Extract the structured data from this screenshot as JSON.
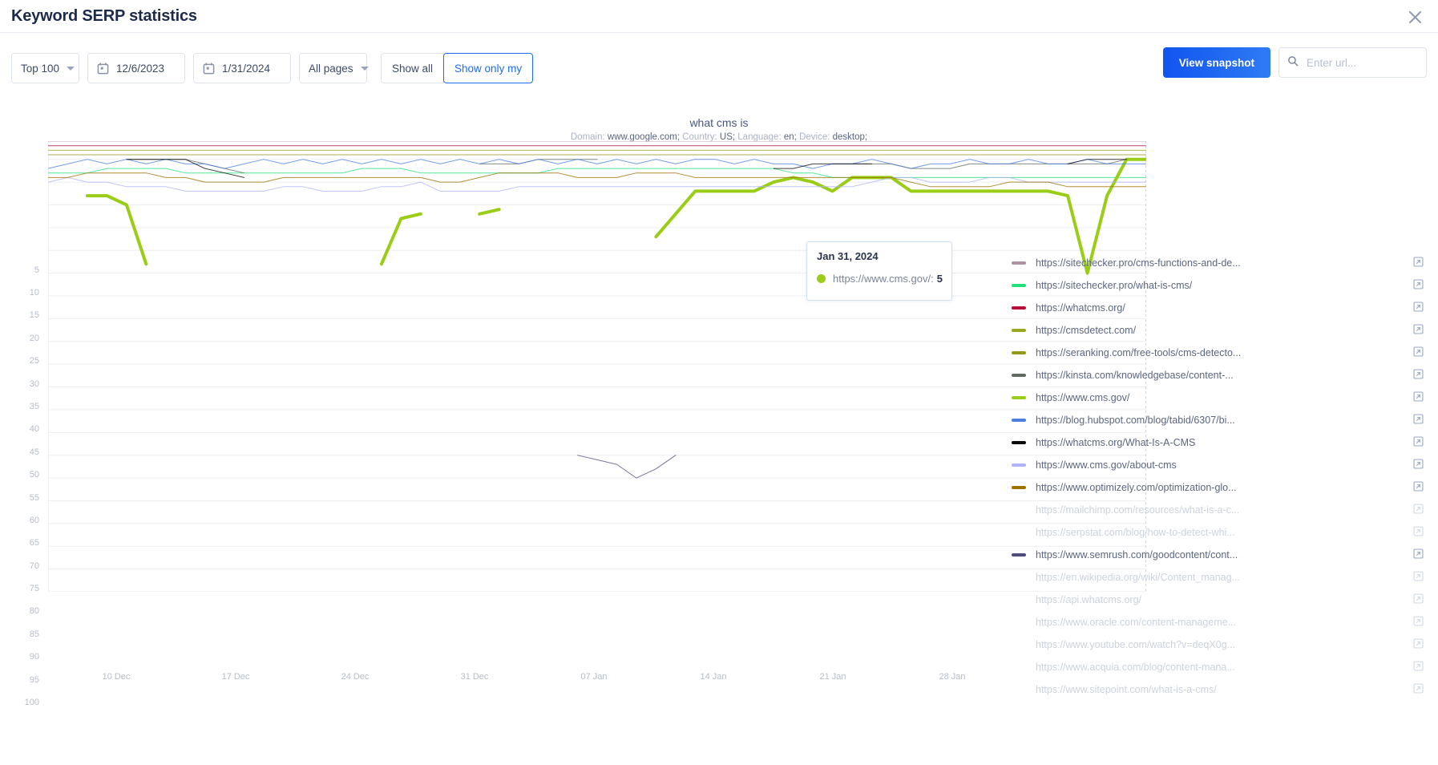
{
  "header": {
    "title": "Keyword SERP statistics",
    "close_icon": "close-icon"
  },
  "toolbar": {
    "top_select": "Top 100",
    "date_from": "12/6/2023",
    "date_to": "1/31/2024",
    "pages_select": "All pages",
    "show_all": "Show all",
    "show_only_my": "Show only my",
    "view_snapshot": "View snapshot",
    "url_placeholder": "Enter url...",
    "url_value": "",
    "accent": "#1c6ef2"
  },
  "tooltip": {
    "date": "Jan 31, 2024",
    "series_label": "https://www.cms.gov/:",
    "value": "5",
    "dot_color": "#9acd15"
  },
  "chart_data": {
    "type": "line",
    "title": "what cms is",
    "subtitle": "Domain: www.google.com; Country: US; Language: en; Device: desktop;",
    "subtitle_parts": [
      {
        "label": "Domain:",
        "value": "www.google.com;"
      },
      {
        "label": "Country:",
        "value": "US;"
      },
      {
        "label": "Language:",
        "value": "en;"
      },
      {
        "label": "Device:",
        "value": "desktop;"
      }
    ],
    "xlabel": "",
    "ylabel": "",
    "ylim": [
      1,
      100
    ],
    "y_inverted": true,
    "yticks": [
      5,
      10,
      15,
      20,
      25,
      30,
      35,
      40,
      45,
      50,
      55,
      60,
      65,
      70,
      75,
      80,
      85,
      90,
      95,
      100
    ],
    "xticks": [
      "10 Dec",
      "17 Dec",
      "24 Dec",
      "31 Dec",
      "07 Jan",
      "14 Jan",
      "21 Jan",
      "28 Jan"
    ],
    "x_start": "06 Dec 2023",
    "x_end": "31 Jan 2024",
    "grid": true,
    "legend_position": "right",
    "highlighted_series": "https://www.cms.gov/",
    "series": [
      {
        "name": "https://sitechecker.pro/cms-functions-and-de...",
        "color": "#ad92a0",
        "enabled": true,
        "values": [
          1,
          1,
          1,
          1,
          1,
          1,
          1,
          1,
          1,
          1,
          1,
          1,
          1,
          1,
          1,
          1,
          1,
          1,
          1,
          1,
          1,
          1,
          1,
          1,
          1,
          1,
          1,
          1,
          1,
          1,
          1,
          1,
          1,
          1,
          1,
          1,
          1,
          1,
          1,
          1,
          1,
          1,
          1,
          1,
          1,
          1,
          1,
          1,
          1,
          1,
          1,
          1,
          1,
          1,
          1,
          1,
          1
        ]
      },
      {
        "name": "https://sitechecker.pro/what-is-cms/",
        "color": "#1fe07a",
        "enabled": true,
        "values": [
          8,
          8,
          8,
          7,
          7,
          7,
          7,
          8,
          8,
          8,
          8,
          8,
          8,
          8,
          8,
          8,
          7,
          7,
          7,
          8,
          8,
          8,
          8,
          8,
          8,
          8,
          7,
          7,
          7,
          7,
          7,
          7,
          7,
          7,
          7,
          7,
          7,
          7,
          8,
          8,
          9,
          9,
          9,
          9,
          9,
          9,
          9,
          9,
          9,
          9,
          9,
          9,
          9,
          9,
          9,
          9,
          9
        ]
      },
      {
        "name": "https://whatcms.org/",
        "color": "#bb0c3c",
        "enabled": true,
        "values": [
          2,
          2,
          2,
          2,
          2,
          2,
          2,
          2,
          2,
          2,
          2,
          2,
          2,
          2,
          2,
          2,
          2,
          2,
          2,
          2,
          2,
          2,
          2,
          2,
          2,
          2,
          2,
          2,
          2,
          2,
          2,
          2,
          2,
          2,
          2,
          2,
          2,
          2,
          2,
          2,
          2,
          2,
          2,
          2,
          2,
          2,
          2,
          2,
          2,
          2,
          2,
          2,
          2,
          2,
          2,
          2,
          2
        ]
      },
      {
        "name": "https://cmsdetect.com/",
        "color": "#9aa820",
        "enabled": true,
        "values": [
          3,
          3,
          3,
          3,
          3,
          3,
          3,
          3,
          3,
          3,
          3,
          3,
          3,
          3,
          3,
          3,
          3,
          3,
          3,
          3,
          3,
          3,
          3,
          3,
          3,
          3,
          3,
          3,
          3,
          3,
          3,
          3,
          3,
          3,
          3,
          3,
          3,
          3,
          3,
          3,
          3,
          3,
          3,
          3,
          3,
          3,
          3,
          3,
          3,
          3,
          3,
          3,
          3,
          3,
          3,
          3,
          3
        ]
      },
      {
        "name": "https://seranking.com/free-tools/cms-detecto...",
        "color": "#96971b",
        "enabled": true,
        "values": [
          4,
          4,
          4,
          4,
          4,
          4,
          4,
          4,
          4,
          4,
          4,
          4,
          4,
          4,
          4,
          4,
          4,
          4,
          4,
          4,
          4,
          4,
          4,
          4,
          4,
          4,
          4,
          4,
          4,
          4,
          4,
          4,
          4,
          4,
          4,
          4,
          4,
          4,
          4,
          4,
          4,
          4,
          4,
          4,
          4,
          4,
          4,
          4,
          4,
          4,
          4,
          4,
          4,
          4,
          4,
          4,
          4
        ]
      },
      {
        "name": "https://kinsta.com/knowledgebase/content-...",
        "color": "#5e6c60",
        "enabled": true,
        "values": [
          null,
          null,
          null,
          null,
          5,
          5,
          5,
          5,
          6,
          7,
          8,
          null,
          null,
          null,
          null,
          null,
          null,
          null,
          null,
          null,
          null,
          null,
          6,
          6,
          6,
          5,
          5,
          5,
          5,
          null,
          null,
          null,
          null,
          null,
          null,
          null,
          null,
          null,
          null,
          null,
          6,
          6,
          6,
          6,
          7,
          7,
          7,
          6,
          6,
          6,
          6,
          6,
          6,
          6,
          6,
          5,
          5
        ]
      },
      {
        "name": "https://www.cms.gov/",
        "color": "#9acd15",
        "enabled": true,
        "values": [
          null,
          null,
          13,
          13,
          15,
          28,
          null,
          null,
          null,
          null,
          null,
          null,
          null,
          null,
          null,
          null,
          null,
          28,
          18,
          17,
          null,
          null,
          17,
          16,
          null,
          null,
          null,
          null,
          null,
          null,
          null,
          22,
          17,
          12,
          12,
          12,
          12,
          10,
          9,
          10,
          12,
          9,
          9,
          9,
          12,
          12,
          12,
          12,
          12,
          12,
          12,
          12,
          13,
          30,
          13,
          5,
          5
        ]
      },
      {
        "name": "https://blog.hubspot.com/blog/tabid/6307/bi...",
        "color": "#4a7fe0",
        "enabled": true,
        "values": [
          7,
          6,
          5,
          6,
          5,
          6,
          5,
          6,
          6,
          7,
          6,
          5,
          6,
          5,
          6,
          5,
          6,
          5,
          6,
          5,
          6,
          5,
          6,
          5,
          6,
          5,
          6,
          5,
          6,
          5,
          6,
          5,
          6,
          5,
          5,
          6,
          5,
          6,
          6,
          7,
          6,
          6,
          5,
          6,
          7,
          6,
          6,
          5,
          6,
          6,
          5,
          6,
          6,
          5,
          6,
          6,
          6
        ]
      },
      {
        "name": "https://whatcms.org/What-Is-A-CMS",
        "color": "#0a0a0a",
        "enabled": true,
        "values": [
          null,
          null,
          null,
          null,
          5,
          5,
          5,
          5,
          7,
          8,
          9,
          null,
          null,
          null,
          null,
          null,
          null,
          null,
          null,
          null,
          null,
          null,
          null,
          null,
          null,
          null,
          null,
          null,
          null,
          null,
          null,
          null,
          null,
          null,
          null,
          null,
          null,
          7,
          7,
          6,
          6,
          6,
          6,
          null,
          null,
          null,
          null,
          null,
          null,
          null,
          null,
          null,
          6,
          5,
          5,
          5,
          null
        ]
      },
      {
        "name": "https://www.cms.gov/about-cms",
        "color": "#b0b3f7",
        "enabled": true,
        "values": [
          10,
          9,
          10,
          10,
          11,
          11,
          11,
          12,
          12,
          12,
          12,
          12,
          11,
          11,
          12,
          12,
          12,
          11,
          11,
          10,
          12,
          12,
          12,
          12,
          11,
          11,
          11,
          11,
          11,
          11,
          11,
          11,
          11,
          11,
          11,
          11,
          11,
          11,
          11,
          11,
          11,
          11,
          10,
          9,
          9,
          10,
          10,
          10,
          9,
          9,
          10,
          10,
          10,
          10,
          10,
          10,
          10
        ]
      },
      {
        "name": "https://www.optimizely.com/optimization-glo...",
        "color": "#9c7003",
        "enabled": true,
        "values": [
          9,
          9,
          8,
          8,
          8,
          8,
          9,
          9,
          10,
          10,
          10,
          10,
          9,
          9,
          9,
          9,
          9,
          9,
          9,
          9,
          10,
          10,
          9,
          8,
          8,
          8,
          8,
          9,
          9,
          9,
          8,
          8,
          8,
          9,
          9,
          9,
          9,
          9,
          9,
          9,
          9,
          9,
          9,
          9,
          10,
          11,
          11,
          11,
          11,
          10,
          10,
          10,
          11,
          11,
          11,
          11,
          11
        ]
      },
      {
        "name": "https://mailchimp.com/resources/what-is-a-c...",
        "color": "#cccccc",
        "enabled": false,
        "values": []
      },
      {
        "name": "https://serpstat.com/blog/how-to-detect-whi...",
        "color": "#cccccc",
        "enabled": false,
        "values": []
      },
      {
        "name": "https://www.semrush.com/goodcontent/cont...",
        "color": "#4e4d80",
        "enabled": true,
        "values": [
          null,
          null,
          null,
          null,
          null,
          null,
          null,
          null,
          null,
          null,
          null,
          null,
          null,
          null,
          null,
          null,
          null,
          null,
          null,
          null,
          null,
          null,
          null,
          null,
          null,
          null,
          null,
          70,
          71,
          72,
          75,
          73,
          70,
          null,
          null,
          null,
          null,
          null,
          null,
          null,
          null,
          null,
          null,
          null,
          null,
          null,
          null,
          null,
          null,
          null,
          null,
          null,
          null,
          null,
          null,
          null,
          null
        ]
      },
      {
        "name": "https://en.wikipedia.org/wiki/Content_manag...",
        "color": "#cccccc",
        "enabled": false,
        "values": []
      },
      {
        "name": "https://api.whatcms.org/",
        "color": "#cccccc",
        "enabled": false,
        "values": []
      },
      {
        "name": "https://www.oracle.com/content-manageme...",
        "color": "#cccccc",
        "enabled": false,
        "values": []
      },
      {
        "name": "https://www.youtube.com/watch?v=deqX0g...",
        "color": "#cccccc",
        "enabled": false,
        "values": []
      },
      {
        "name": "https://www.acquia.com/blog/content-mana...",
        "color": "#cccccc",
        "enabled": false,
        "values": []
      }
    ]
  },
  "legend": {
    "items": [
      {
        "label": "https://sitechecker.pro/cms-functions-and-de...",
        "color": "#ad92a0",
        "enabled": true
      },
      {
        "label": "https://sitechecker.pro/what-is-cms/",
        "color": "#1fe07a",
        "enabled": true
      },
      {
        "label": "https://whatcms.org/",
        "color": "#bb0c3c",
        "enabled": true
      },
      {
        "label": "https://cmsdetect.com/",
        "color": "#9aa820",
        "enabled": true
      },
      {
        "label": "https://seranking.com/free-tools/cms-detecto...",
        "color": "#96971b",
        "enabled": true
      },
      {
        "label": "https://kinsta.com/knowledgebase/content-...",
        "color": "#5e6c60",
        "enabled": true
      },
      {
        "label": "https://www.cms.gov/",
        "color": "#9acd15",
        "enabled": true
      },
      {
        "label": "https://blog.hubspot.com/blog/tabid/6307/bi...",
        "color": "#4a7fe0",
        "enabled": true
      },
      {
        "label": "https://whatcms.org/What-Is-A-CMS",
        "color": "#0a0a0a",
        "enabled": true
      },
      {
        "label": "https://www.cms.gov/about-cms",
        "color": "#b0b3f7",
        "enabled": true
      },
      {
        "label": "https://www.optimizely.com/optimization-glo...",
        "color": "#9c7003",
        "enabled": true
      },
      {
        "label": "https://mailchimp.com/resources/what-is-a-c...",
        "color": "#cccccc",
        "enabled": false
      },
      {
        "label": "https://serpstat.com/blog/how-to-detect-whi...",
        "color": "#cccccc",
        "enabled": false
      },
      {
        "label": "https://www.semrush.com/goodcontent/cont...",
        "color": "#4e4d80",
        "enabled": true
      },
      {
        "label": "https://en.wikipedia.org/wiki/Content_manag...",
        "color": "#cccccc",
        "enabled": false
      },
      {
        "label": "https://api.whatcms.org/",
        "color": "#cccccc",
        "enabled": false
      },
      {
        "label": "https://www.oracle.com/content-manageme...",
        "color": "#cccccc",
        "enabled": false
      },
      {
        "label": "https://www.youtube.com/watch?v=deqX0g...",
        "color": "#cccccc",
        "enabled": false
      },
      {
        "label": "https://www.acquia.com/blog/content-mana...",
        "color": "#cccccc",
        "enabled": false
      },
      {
        "label": "https://www.sitepoint.com/what-is-a-cms/",
        "color": "#cccccc",
        "enabled": false
      }
    ]
  }
}
